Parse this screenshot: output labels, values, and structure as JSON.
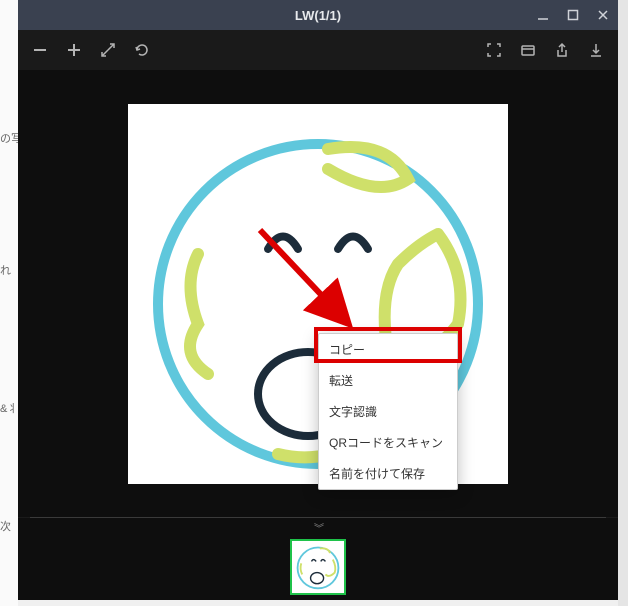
{
  "window": {
    "title": "LW(1/1)"
  },
  "toolbar": {
    "zoom_out": "−",
    "zoom_in": "+",
    "fit": "fit-icon",
    "rotate": "rotate-icon"
  },
  "context_menu": {
    "items": [
      {
        "label": "コピー"
      },
      {
        "label": "転送"
      },
      {
        "label": "文字認識"
      },
      {
        "label": "QRコードをスキャン"
      },
      {
        "label": "名前を付けて保存"
      }
    ]
  },
  "sidebar_fragments": {
    "a": "の写",
    "b": "れ",
    "c": "&丬",
    "d": "次"
  }
}
